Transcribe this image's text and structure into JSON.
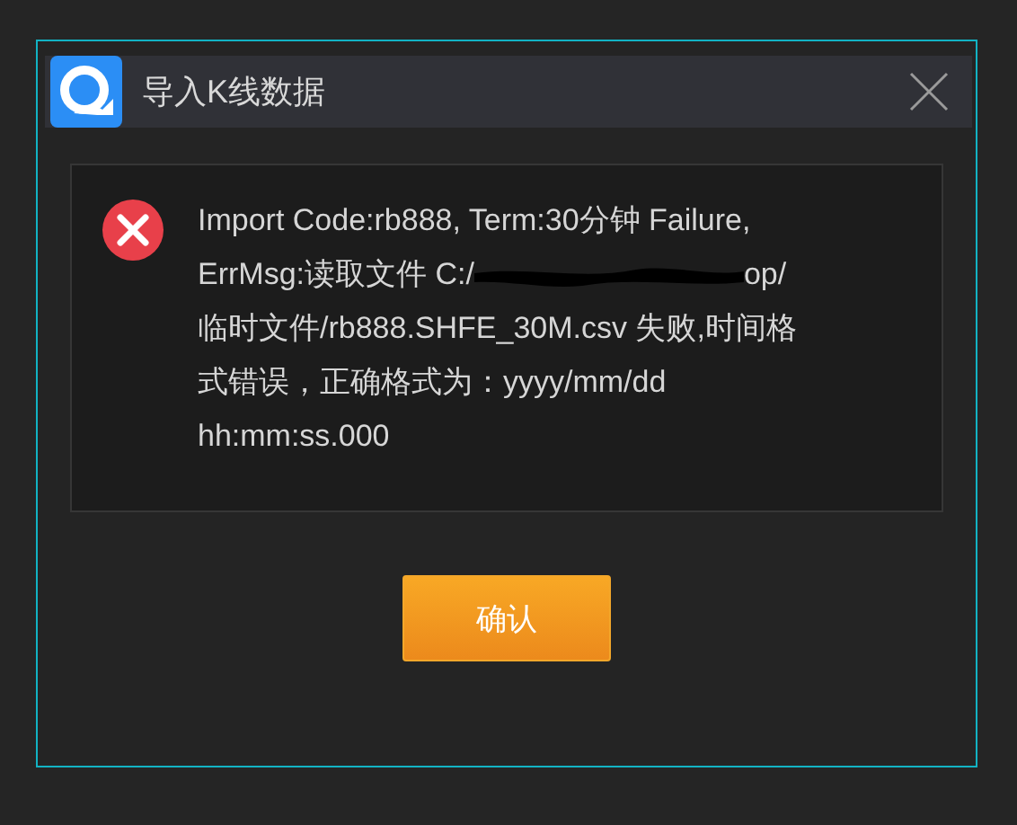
{
  "window": {
    "title": "导入K线数据"
  },
  "message": {
    "kind": "error",
    "lines": [
      {
        "kind": "text",
        "text": "Import Code:rb888, Term:30分钟 Failure,"
      },
      {
        "kind": "redacted",
        "before": "ErrMsg:读取文件 C:/",
        "after": "op/"
      },
      {
        "kind": "text",
        "text": "临时文件/rb888.SHFE_30M.csv 失败,时间格"
      },
      {
        "kind": "text",
        "text": "式错误，正确格式为：yyyy/mm/dd"
      },
      {
        "kind": "text",
        "text": "hh:mm:ss.000"
      }
    ]
  },
  "buttons": [
    "确认"
  ]
}
